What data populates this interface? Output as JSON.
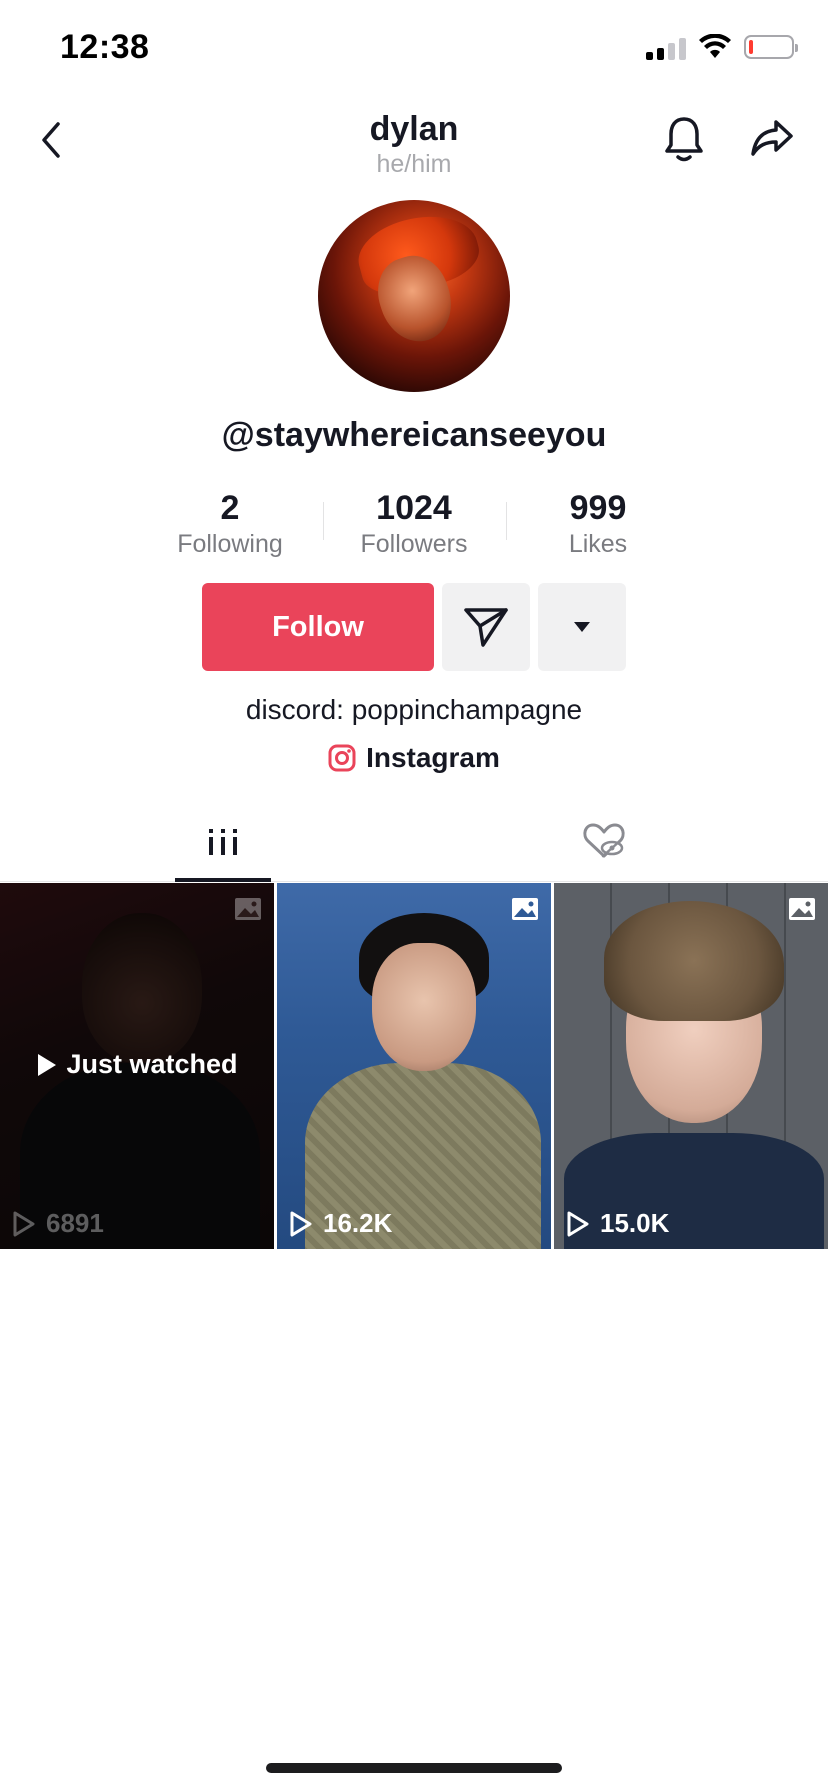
{
  "status_bar": {
    "time": "12:38",
    "battery_color": "#ff3b30"
  },
  "nav": {
    "title": "dylan",
    "subtitle": "he/him",
    "back_icon": "chevron-left-icon",
    "bell_icon": "bell-icon",
    "share_icon": "share-arrow-icon"
  },
  "profile": {
    "username": "@staywhereicanseeyou",
    "stats": [
      {
        "value": "2",
        "label": "Following"
      },
      {
        "value": "1024",
        "label": "Followers"
      },
      {
        "value": "999",
        "label": "Likes"
      }
    ],
    "follow_label": "Follow",
    "accent_color": "#ea445a",
    "bio": "discord: poppinchampagne",
    "instagram_label": "Instagram"
  },
  "tabs": [
    {
      "icon": "grid-icon",
      "active": true
    },
    {
      "icon": "hidden-likes-icon",
      "active": false
    }
  ],
  "videos": [
    {
      "views": "6891",
      "overlay": "Just watched",
      "type_icon": "photo-icon"
    },
    {
      "views": "16.2K",
      "type_icon": "photo-icon"
    },
    {
      "views": "15.0K",
      "type_icon": "photo-icon"
    }
  ]
}
